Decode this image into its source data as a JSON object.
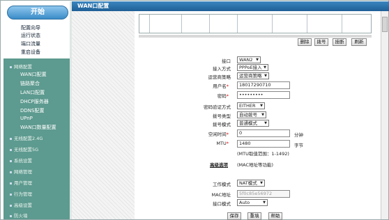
{
  "sidebar": {
    "start": "开始",
    "top_items": [
      "配置向导",
      "运行状态",
      "端口流量",
      "重启设备"
    ],
    "groups": [
      "网络配置",
      "无线配置2.4G",
      "无线配置5G",
      "系统设置",
      "网络管理",
      "用户管理",
      "行为管理",
      "高级设置",
      "防火墙"
    ],
    "network_items": [
      "WAN口配置",
      "链路聚合",
      "LAN口配置",
      "DHCP服务器",
      "DDNS配置",
      "UPnP",
      "WAN口数量配置"
    ]
  },
  "header": {
    "title": "WAN口配置"
  },
  "table_buttons": [
    "删除",
    "拨号",
    "挂断",
    "刷新"
  ],
  "form": {
    "port": {
      "label": "接口",
      "value": "WAN2"
    },
    "access": {
      "label": "接入方式",
      "value": "PPPoE接入"
    },
    "isp": {
      "label": "运营商策略",
      "value": "运营商策略"
    },
    "username": {
      "label": "用户名",
      "value": "18017290710"
    },
    "password": {
      "label": "密码",
      "value": "•••••••••"
    },
    "auth": {
      "label": "密码验证方式",
      "value": "EITHER"
    },
    "dial_type": {
      "label": "拨号类型",
      "value": "自动拨号"
    },
    "dial_mode": {
      "label": "拨号模式",
      "value": "普通模式"
    },
    "idle": {
      "label": "空闲时间",
      "value": "0",
      "unit": "分钟"
    },
    "mtu": {
      "label": "MTU",
      "value": "1480",
      "unit": "字节",
      "hint": "(MTU取值范围：1-1492)"
    },
    "advanced": {
      "label": "高级选项",
      "hint": "(MAC地址等功能)"
    },
    "work_mode": {
      "label": "工作模式",
      "value": "NAT模式"
    },
    "mac": {
      "label": "MAC地址",
      "value": "5f0c85e56972"
    },
    "port_mode": {
      "label": "接口模式",
      "value": "Auto"
    }
  },
  "footer_buttons": [
    "保存",
    "重填",
    "帮助"
  ]
}
